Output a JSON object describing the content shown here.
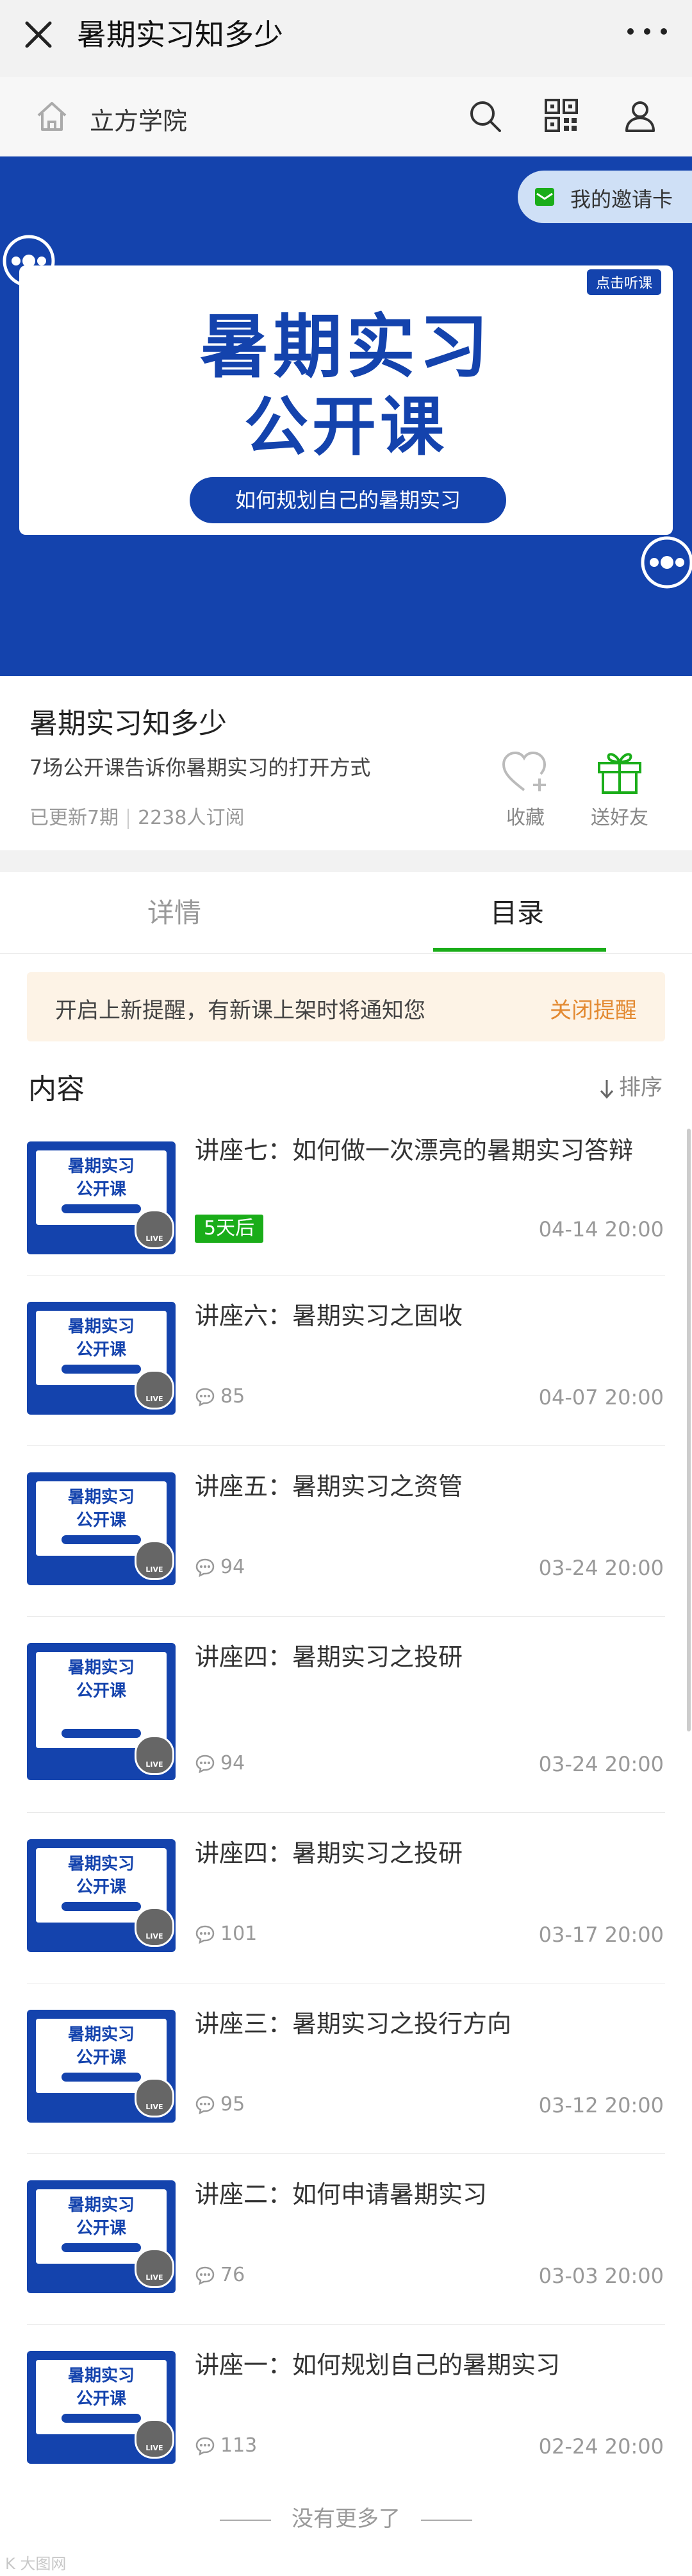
{
  "topbar": {
    "title": "暑期实习知多少"
  },
  "navbar": {
    "site_name": "立方学院"
  },
  "banner": {
    "title_line1": "暑期实习",
    "title_line2": "公开课",
    "subtitle": "如何规划自己的暑期实习",
    "listen_tag": "点击听课",
    "invite_label": "我的邀请卡"
  },
  "course": {
    "title": "暑期实习知多少",
    "description": "7场公开课告诉你暑期实习的打开方式",
    "updated": "已更新7期",
    "subscribers": "2238人订阅",
    "favorite_label": "收藏",
    "gift_label": "送好友"
  },
  "tabs": {
    "detail": "详情",
    "catalog": "目录"
  },
  "reminder": {
    "message": "开启上新提醒，有新课上架时将通知您",
    "close_label": "关闭提醒"
  },
  "content": {
    "heading": "内容",
    "sort_label": "排序"
  },
  "thumb": {
    "line1": "暑期实习",
    "line2": "公开课",
    "live": "LIVE"
  },
  "lectures": [
    {
      "title": "讲座七：如何做一次漂亮的暑期实习答辩",
      "badge": "5天后",
      "comments": "",
      "date": "04-14 20:00"
    },
    {
      "title": "讲座六：暑期实习之固收",
      "badge": "",
      "comments": "85",
      "date": "04-07 20:00"
    },
    {
      "title": "讲座五：暑期实习之资管",
      "badge": "",
      "comments": "94",
      "date": "03-24 20:00"
    },
    {
      "title": "讲座四：暑期实习之投研",
      "badge": "",
      "comments": "94",
      "date": "03-24 20:00"
    },
    {
      "title": "讲座四：暑期实习之投研",
      "badge": "",
      "comments": "101",
      "date": "03-17 20:00"
    },
    {
      "title": "讲座三：暑期实习之投行方向",
      "badge": "",
      "comments": "95",
      "date": "03-12 20:00"
    },
    {
      "title": "讲座二：如何申请暑期实习",
      "badge": "",
      "comments": "76",
      "date": "03-03 20:00"
    },
    {
      "title": "讲座一：如何规划自己的暑期实习",
      "badge": "",
      "comments": "113",
      "date": "02-24 20:00"
    }
  ],
  "footer": {
    "no_more": "没有更多了"
  },
  "watermark": "K  大图网"
}
